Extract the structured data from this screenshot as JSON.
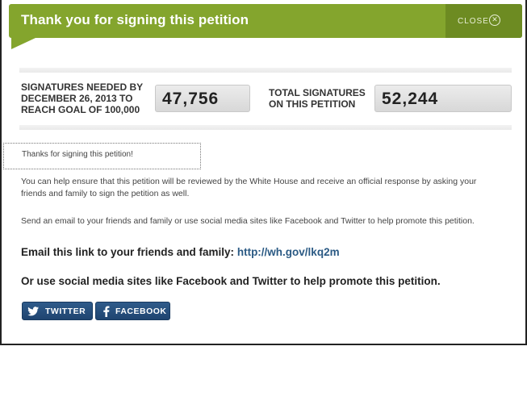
{
  "header": {
    "title": "Thank you for signing this petition",
    "close_label": "CLOSE",
    "close_icon": "close-circle-icon",
    "color": "#84a52d"
  },
  "stats": {
    "needed_label_line1": "SIGNATURES NEEDED BY",
    "needed_label_line2": "DECEMBER 26, 2013 TO",
    "needed_label_line3": "REACH GOAL OF 100,000",
    "needed_value": "47,756",
    "total_label_line1": "TOTAL SIGNATURES",
    "total_label_line2": "ON THIS PETITION",
    "total_value": "52,244"
  },
  "thanks": {
    "message": "Thanks for signing this petition!"
  },
  "body": {
    "para1_line1": "You can help ensure that this petition will be reviewed by the White House and receive an official response by asking your",
    "para1_line2": "friends and family to sign the petition as well.",
    "para2": "Send an email to your friends and family or use social media sites like Facebook and Twitter to help promote this petition.",
    "email_prefix": "Email this link to your friends and family:",
    "email_link": "http://wh.gov/lkq2m",
    "social_line": "Or use social media sites like Facebook and Twitter to help promote this petition."
  },
  "social": {
    "twitter_label": "TWITTER",
    "twitter_icon": "twitter-bird-icon",
    "facebook_label": "FACEBOOK",
    "facebook_icon": "facebook-f-icon",
    "button_color": "#2a5283"
  }
}
